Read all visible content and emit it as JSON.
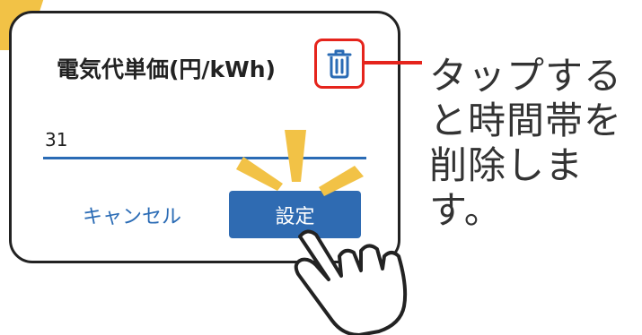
{
  "dialog": {
    "title": "電気代単価(円/kWh)",
    "rate_value": "31",
    "cancel_label": "キャンセル",
    "set_label": "設定"
  },
  "callout": {
    "text": "タップする\nと時間帯を\n削除します。"
  },
  "icons": {
    "delete": "trash-icon",
    "pointer": "tap-hand-icon"
  },
  "colors": {
    "accent_blue": "#2f6bb2",
    "highlight_red": "#e5241c",
    "burst_yellow": "#f2c246"
  }
}
